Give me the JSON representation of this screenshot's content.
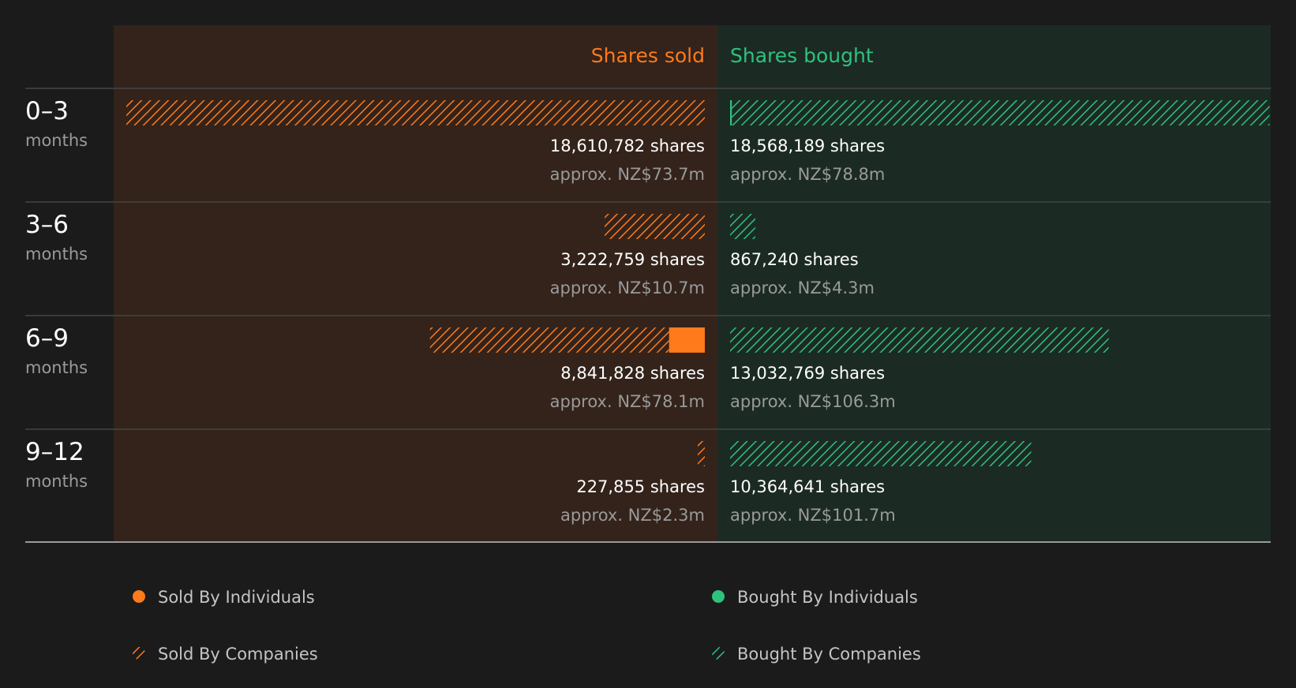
{
  "chart_data": {
    "type": "bar",
    "orientation": "horizontal-diverging",
    "headers": {
      "sold": "Shares sold",
      "bought": "Shares bought"
    },
    "colors": {
      "sold": "#ff7a1a",
      "bought": "#2ec27e",
      "sold_panel": "#33231b",
      "bought_panel": "#1c2a24",
      "background": "#1b1b1b"
    },
    "categories": [
      {
        "range": "0–3",
        "unit": "months"
      },
      {
        "range": "3–6",
        "unit": "months"
      },
      {
        "range": "6–9",
        "unit": "months"
      },
      {
        "range": "9–12",
        "unit": "months"
      }
    ],
    "series": [
      {
        "name": "Sold By Individuals",
        "side": "sold",
        "pattern": "solid",
        "values": [
          0,
          0,
          1150000,
          0
        ]
      },
      {
        "name": "Sold By Companies",
        "side": "sold",
        "pattern": "hatched",
        "values": [
          18610782,
          3222759,
          7691828,
          227855
        ]
      },
      {
        "name": "Bought By Individuals",
        "side": "bought",
        "pattern": "solid",
        "values": [
          60000,
          0,
          0,
          0
        ]
      },
      {
        "name": "Bought By Companies",
        "side": "bought",
        "pattern": "hatched",
        "values": [
          18508189,
          867240,
          13032769,
          10364641
        ]
      }
    ],
    "totals": {
      "sold": [
        {
          "shares": "18,610,782 shares",
          "value": "approx. NZ$73.7m"
        },
        {
          "shares": "3,222,759 shares",
          "value": "approx. NZ$10.7m"
        },
        {
          "shares": "8,841,828 shares",
          "value": "approx. NZ$78.1m"
        },
        {
          "shares": "227,855 shares",
          "value": "approx. NZ$2.3m"
        }
      ],
      "bought": [
        {
          "shares": "18,568,189 shares",
          "value": "approx. NZ$78.8m"
        },
        {
          "shares": "867,240 shares",
          "value": "approx. NZ$4.3m"
        },
        {
          "shares": "13,032,769 shares",
          "value": "approx. NZ$106.3m"
        },
        {
          "shares": "10,364,641 shares",
          "value": "approx. NZ$101.7m"
        }
      ]
    },
    "xlim": [
      0,
      18610782
    ],
    "legend_position": "bottom"
  }
}
